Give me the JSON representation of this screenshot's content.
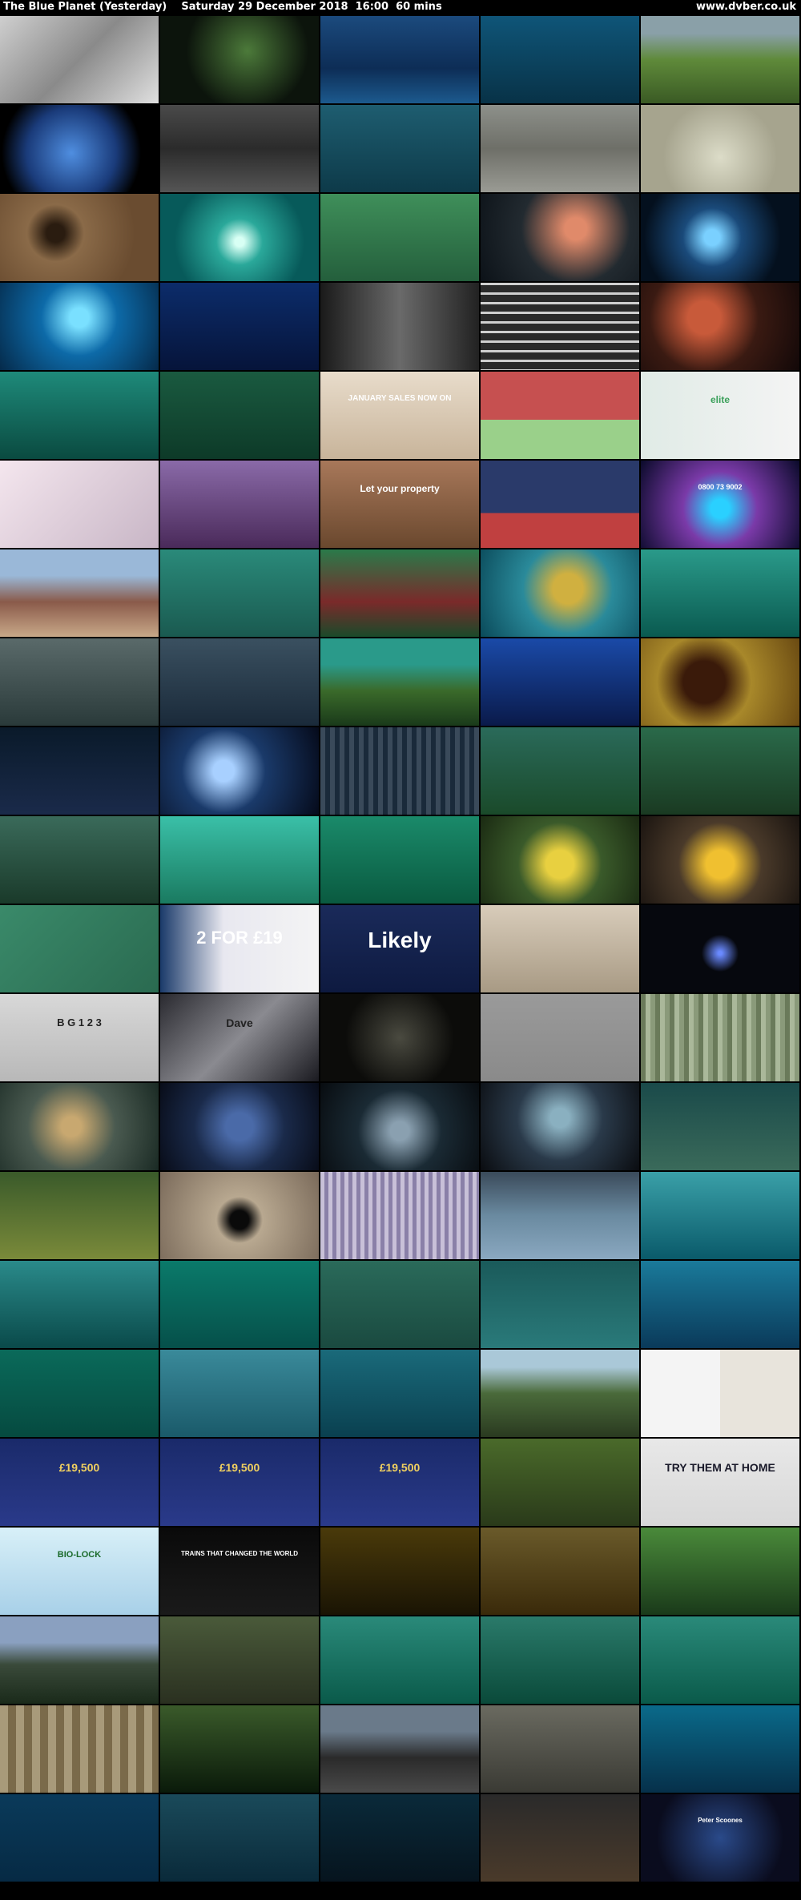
{
  "header": {
    "title": "The Blue Planet (Yesterday)    Saturday 29 December 2018  16:00  60 mins",
    "site": "www.dvber.co.uk"
  },
  "thumbnails": [
    {
      "bg": "linear-gradient(135deg,#cfcfcf,#8a8a8a 50%,#e0e0e0)"
    },
    {
      "bg": "radial-gradient(circle at 55% 40%,#4c7a3a,#0c140c 60%)"
    },
    {
      "bg": "linear-gradient(180deg,#1b4a7d,#0d2d56 60%,#1c5a8e)"
    },
    {
      "bg": "linear-gradient(180deg,#0f5578,#083247)"
    },
    {
      "bg": "linear-gradient(180deg,#8aa0a8 20%,#5f8a3a 50%,#3a5a24)"
    },
    {
      "bg": "radial-gradient(circle at 45% 55%,#4f8ee0,#1a3b7a 45%,#000 70%)"
    },
    {
      "bg": "linear-gradient(180deg,#4a4a4a,#2b2b2b 50%,#555)"
    },
    {
      "bg": "linear-gradient(180deg,#1e5d70,#0d3a49)"
    },
    {
      "bg": "linear-gradient(180deg,#8d908a,#6e6f68 50%,#9a9b94)"
    },
    {
      "bg": "radial-gradient(circle at 50% 60%,#dcdcc8,#a6a48e 60%)"
    },
    {
      "bg": "radial-gradient(circle at 35% 45%,#2a1c10 8%,#8a6a48 25%,#6a4c30 70%)"
    },
    {
      "bg": "radial-gradient(circle at 50% 55%,#d8fff4 5%,#2aa89a 25%,#075a5a 70%)"
    },
    {
      "bg": "linear-gradient(180deg,#3f8f5a,#245f3c)"
    },
    {
      "bg": "radial-gradient(circle at 60% 40%,#e08a6a 10%,#222a30 50%,#0c1218)"
    },
    {
      "bg": "radial-gradient(circle at 45% 50%,#7ad0ff 8%,#1a4a7a 30%,#04101e 70%)"
    },
    {
      "bg": "radial-gradient(circle at 50% 40%,#7ae0ff 10%,#0d6aa8 40%,#052a4a)"
    },
    {
      "bg": "linear-gradient(180deg,#0c2c6a,#06143a)"
    },
    {
      "bg": "linear-gradient(90deg,#1a1a1a,#6a6a6a 50%,#222)"
    },
    {
      "bg": "repeating-linear-gradient(180deg,#cfcfcf 0 3px,#2a2a2a 3px 12px)"
    },
    {
      "bg": "radial-gradient(circle at 40% 40%,#c85a3a 15%,#3a1a12 50%,#120808)"
    },
    {
      "bg": "linear-gradient(180deg,#1e8a7a,#0a4a40)"
    },
    {
      "bg": "linear-gradient(180deg,#1a5a40,#0d3a28)"
    },
    {
      "bg": "linear-gradient(180deg,#e8dccb,#c8b49a)",
      "text": "JANUARY SALES NOW ON",
      "textColor": "#fff",
      "textSize": "10px"
    },
    {
      "bg": "linear-gradient(180deg,#c65050 0 55%,#9ad08a 55%)"
    },
    {
      "bg": "linear-gradient(90deg,#e0ebe6,#f4f4f4)",
      "text": "elite",
      "textColor": "#3aa05a",
      "textSize": "12px"
    },
    {
      "bg": "linear-gradient(135deg,#f4e6ee,#c8b6c6)"
    },
    {
      "bg": "linear-gradient(180deg,#8a6aa8,#4a2a5a)"
    },
    {
      "bg": "linear-gradient(180deg,#a8785a,#6a482e)",
      "text": "Let your property",
      "textColor": "#fff",
      "textSize": "12px"
    },
    {
      "bg": "linear-gradient(180deg,#2a3a6a 60%,#c04040 60%)"
    },
    {
      "bg": "radial-gradient(circle at 50% 55%,#2ad0ff 10%,#7a3aa8 40%,#0a0a2a)",
      "text": "0800 73 9002",
      "textColor": "#fff",
      "textSize": "9px"
    },
    {
      "bg": "linear-gradient(180deg,#9ab8d8 30%,#8a5a4a 60%,#c8a888)"
    },
    {
      "bg": "linear-gradient(180deg,#2a8a7a,#1a5a50)"
    },
    {
      "bg": "linear-gradient(180deg,#2a7a4a,#7a2a2a 60%,#1a4a2a)"
    },
    {
      "bg": "radial-gradient(circle at 55% 45%,#d0b040 15%,#2a8a9a 45%,#0a4a5a)"
    },
    {
      "bg": "linear-gradient(180deg,#2a9a8a,#0a5a50)"
    },
    {
      "bg": "linear-gradient(180deg,#5a6a6a,#2a3a3a)"
    },
    {
      "bg": "linear-gradient(180deg,#3a5060,#1a2a3a)"
    },
    {
      "bg": "linear-gradient(180deg,#2a9a8a 30%,#3a6a2a 60%,#1a3a1a)"
    },
    {
      "bg": "linear-gradient(180deg,#1a4aa8,#0a1a4a)"
    },
    {
      "bg": "radial-gradient(circle at 40% 50%,#3a1a0a 20%,#a8882a 45%,#6a4a12)"
    },
    {
      "bg": "linear-gradient(180deg,#0a1a2a,#1a2a4a)"
    },
    {
      "bg": "radial-gradient(circle at 40% 50%,#a8d0ff 10%,#1a3a6a 40%,#050a1a)"
    },
    {
      "bg": "repeating-linear-gradient(90deg,#3a4a5a 0 6px,#1a2a3a 6px 12px)"
    },
    {
      "bg": "linear-gradient(180deg,#2a6a5a,#1a4a2a)"
    },
    {
      "bg": "linear-gradient(180deg,#2a6a4a,#1a3a22)"
    },
    {
      "bg": "linear-gradient(180deg,#3a6a5a,#1a3a2a)"
    },
    {
      "bg": "linear-gradient(180deg,#3ac0a8,#1a7a60)"
    },
    {
      "bg": "linear-gradient(180deg,#1a8a6a,#0a5a40)"
    },
    {
      "bg": "radial-gradient(circle at 50% 55%,#e8d040 15%,#3a5a2a 45%,#1a2a12)"
    },
    {
      "bg": "radial-gradient(circle at 50% 55%,#f0c030 15%,#4a3a2a 45%,#1a1410)"
    },
    {
      "bg": "linear-gradient(135deg,#3a8a6a,#2a6a50)"
    },
    {
      "bg": "linear-gradient(90deg,#1a3a6a,#e8e8f0 40%,#f4f4f4)",
      "text": "2 FOR £19",
      "textColor": "#fff",
      "textSize": "22px"
    },
    {
      "bg": "linear-gradient(180deg,#1a2a5a,#0e1a40)",
      "text": "Likely",
      "textColor": "#fff",
      "textSize": "28px"
    },
    {
      "bg": "linear-gradient(180deg,#d8ccba,#a89a84)"
    },
    {
      "bg": "radial-gradient(circle at 50% 55%,#6a8aff 2%,#06080e 20%)"
    },
    {
      "bg": "linear-gradient(180deg,#d8d8d8,#b8b8b8)",
      "text": "B G 1 2 3",
      "textColor": "#222",
      "textSize": "13px"
    },
    {
      "bg": "linear-gradient(135deg,#2a2a30,#8a8a90 50%,#1a1a20)",
      "text": "Dave",
      "textColor": "#222",
      "textSize": "14px"
    },
    {
      "bg": "radial-gradient(circle at 50% 50%,#4a4a40,#0c0c0a 60%)"
    },
    {
      "bg": "linear-gradient(180deg,#9a9a9a,#8a8a8a)"
    },
    {
      "bg": "repeating-linear-gradient(90deg,#6a7a5a 0 6px,#aab89a 6px 12px,#8a9a7a 12px 18px)"
    },
    {
      "bg": "radial-gradient(circle at 45% 50%,#c8a870 10%,#4a5a50 45%,#1a2a24)"
    },
    {
      "bg": "radial-gradient(circle at 50% 50%,#4a6aa8 15%,#1a2a4a 50%,#080c18)"
    },
    {
      "bg": "radial-gradient(circle at 50% 55%,#8aa0b0 10%,#1a2a34 45%,#080c10)"
    },
    {
      "bg": "radial-gradient(circle at 50% 40%,#8ab0c0 10%,#2a3a4a 45%,#0a0c10)"
    },
    {
      "bg": "linear-gradient(180deg,#1a4a4a,#3a6a5a)"
    },
    {
      "bg": "linear-gradient(180deg,#3a5a2a,#7a8a3a)"
    },
    {
      "bg": "radial-gradient(circle at 50% 55%,#0a0a0a 10%,#b8a890 25%,#7a6a5a)"
    },
    {
      "bg": "repeating-linear-gradient(90deg,#c8c0d8 0 5px,#8a80a8 5px 10px)"
    },
    {
      "bg": "linear-gradient(180deg,#3a4a5a,#6a8aa0 50%,#8aa8c0)"
    },
    {
      "bg": "linear-gradient(180deg,#3aa0a8,#0a5a6a)"
    },
    {
      "bg": "linear-gradient(180deg,#2a8a8a,#0a4a4a)"
    },
    {
      "bg": "linear-gradient(180deg,#0a7a6a,#06504a)"
    },
    {
      "bg": "linear-gradient(180deg,#2a6a5a,#1a4a40)"
    },
    {
      "bg": "linear-gradient(180deg,#1a5a5a,#2a7a7a)"
    },
    {
      "bg": "linear-gradient(180deg,#1a7a9a,#0a3a5a)"
    },
    {
      "bg": "linear-gradient(180deg,#0a6a5a,#064a40)"
    },
    {
      "bg": "linear-gradient(180deg,#3a8a9a,#1a5a6a)"
    },
    {
      "bg": "linear-gradient(180deg,#1a6a7a,#0a4050)"
    },
    {
      "bg": "linear-gradient(180deg,#aac8d8 20%,#4a6a3a 50%,#2a3a20)"
    },
    {
      "bg": "linear-gradient(90deg,#f4f4f4 50%,#e8e4dc 50%)"
    },
    {
      "bg": "linear-gradient(180deg,#1a2a6a,#2a3a8a)",
      "text": "£19,500",
      "textColor": "#f0d060",
      "textSize": "14px"
    },
    {
      "bg": "linear-gradient(180deg,#1a2a6a,#2a3a8a)",
      "text": "£19,500",
      "textColor": "#f0d060",
      "textSize": "14px"
    },
    {
      "bg": "linear-gradient(180deg,#1a2a6a,#2a3a8a)",
      "text": "£19,500",
      "textColor": "#f0d060",
      "textSize": "14px"
    },
    {
      "bg": "linear-gradient(180deg,#4a6a2a,#2a3a1a)"
    },
    {
      "bg": "linear-gradient(180deg,#e8e8e8,#d8d8d8)",
      "text": "TRY THEM AT HOME",
      "textColor": "#1a1a2a",
      "textSize": "14px"
    },
    {
      "bg": "linear-gradient(180deg,#d8f0f8,#a8d0e8)",
      "text": "BIO-LOCK",
      "textColor": "#1a6a2a",
      "textSize": "11px"
    },
    {
      "bg": "linear-gradient(180deg,#0a0a0a,#1a1a1a)",
      "text": "TRAINS THAT CHANGED THE WORLD",
      "textColor": "#fff",
      "textSize": "8px"
    },
    {
      "bg": "linear-gradient(180deg,#4a3a0a,#1a1404)"
    },
    {
      "bg": "linear-gradient(180deg,#6a5a2a,#3a2a0a)"
    },
    {
      "bg": "linear-gradient(180deg,#4a8a3a,#1a3a1a)"
    },
    {
      "bg": "linear-gradient(180deg,#8aa0c0 30%,#3a4a3a 55%,#1a2a1a)"
    },
    {
      "bg": "linear-gradient(180deg,#4a5a3a,#2a3020)"
    },
    {
      "bg": "linear-gradient(180deg,#2a8a7a,#0a5a4a)"
    },
    {
      "bg": "linear-gradient(180deg,#2a7a6a,#0a4a3a)"
    },
    {
      "bg": "linear-gradient(180deg,#2a8a7a,#0a5a4a)"
    },
    {
      "bg": "repeating-linear-gradient(90deg,#a89a7a 0 10px,#7a6a4a 10px 20px)"
    },
    {
      "bg": "linear-gradient(180deg,#3a5a2a,#0a1a0a)"
    },
    {
      "bg": "linear-gradient(180deg,#6a7a8a 30%,#2a2a2a 60%,#4a4a4a)"
    },
    {
      "bg": "linear-gradient(180deg,#6a6a60,#3a3a34)"
    },
    {
      "bg": "linear-gradient(180deg,#0a6a8a,#06304a)"
    },
    {
      "bg": "linear-gradient(180deg,#0a3a5a,#062a44)"
    },
    {
      "bg": "linear-gradient(180deg,#1a4a5a,#0a2a3a)"
    },
    {
      "bg": "linear-gradient(180deg,#0a2a3a,#06141e)"
    },
    {
      "bg": "linear-gradient(180deg,#2a2a2a,#4a3a2a)"
    },
    {
      "bg": "radial-gradient(circle at 50% 50%,#2a4a8a,#0a0c1e 70%)",
      "text": "Peter Scoones",
      "textColor": "#fff",
      "textSize": "8px"
    }
  ]
}
